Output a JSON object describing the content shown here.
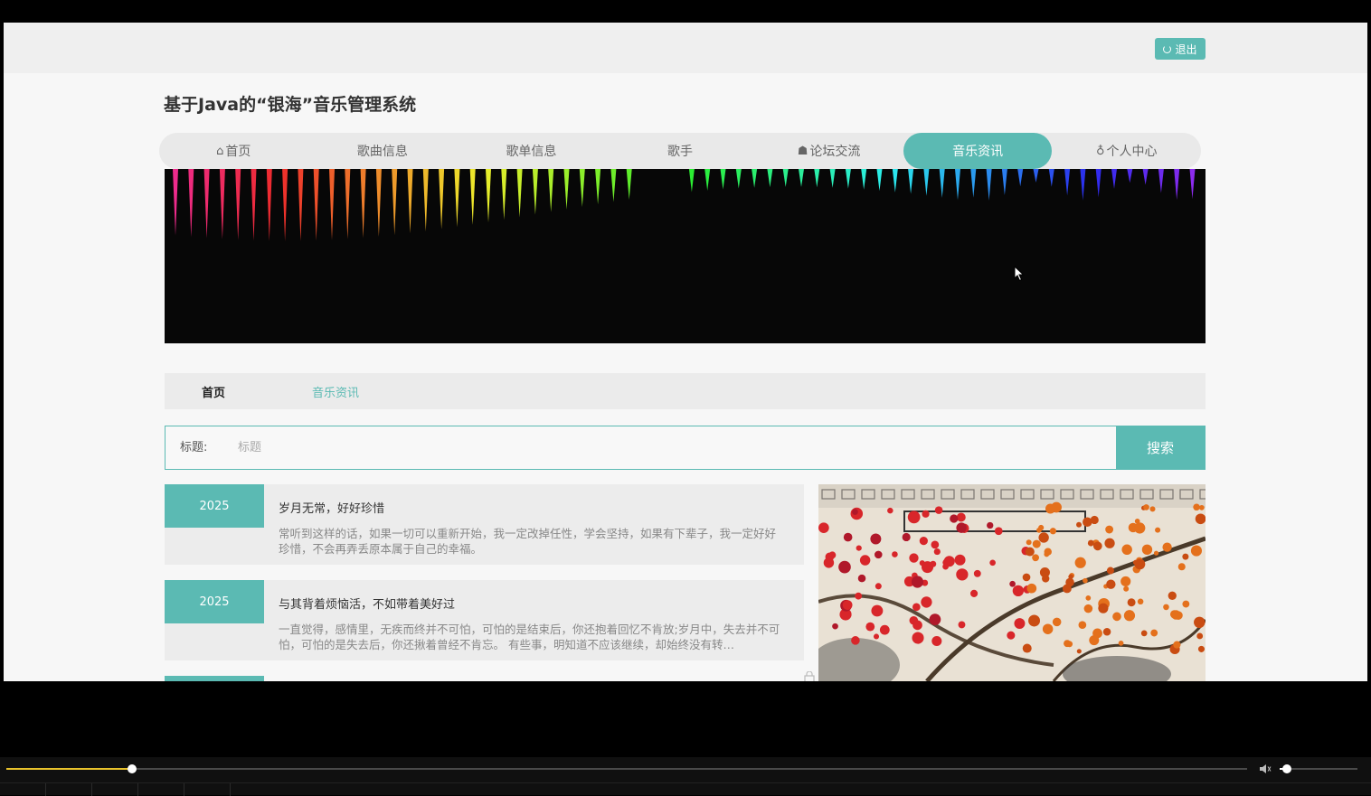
{
  "header": {
    "logout_label": "退出",
    "site_title": "基于Java的“银海”音乐管理系统"
  },
  "nav": {
    "items": [
      {
        "label": "首页",
        "icon": "home-icon",
        "active": false
      },
      {
        "label": "歌曲信息",
        "active": false
      },
      {
        "label": "歌单信息",
        "active": false
      },
      {
        "label": "歌手",
        "active": false
      },
      {
        "label": "论坛交流",
        "icon": "forum-icon",
        "active": false
      },
      {
        "label": "音乐资讯",
        "active": true
      },
      {
        "label": "个人中心",
        "icon": "user-icon",
        "active": false
      }
    ]
  },
  "breadcrumb": {
    "home": "首页",
    "current": "音乐资讯"
  },
  "search": {
    "label": "标题:",
    "placeholder": "标题",
    "value": "",
    "button_label": "搜索"
  },
  "news": [
    {
      "year": "2025",
      "title": "岁月无常，好好珍惜",
      "desc": "常听到这样的话，如果一切可以重新开始，我一定改掉任性，学会坚持，如果有下辈子，我一定好好珍惜，不会再弄丢原本属于自己的幸福。"
    },
    {
      "year": "2025",
      "title": "与其背着烦恼活，不如带着美好过",
      "desc": "一直觉得，感情里，无疾而终并不可怕，可怕的是结束后，你还抱着回忆不肯放;岁月中，失去并不可怕，可怕的是失去后，你还揪着曾经不肯忘。 有些事，明知道不应该继续，却始终没有转…"
    }
  ],
  "player": {
    "progress": 0.101,
    "volume": 0.09
  },
  "colors": {
    "accent": "#5bbab3",
    "page_bg": "#f7f7f7",
    "banner_bg": "#070707"
  }
}
